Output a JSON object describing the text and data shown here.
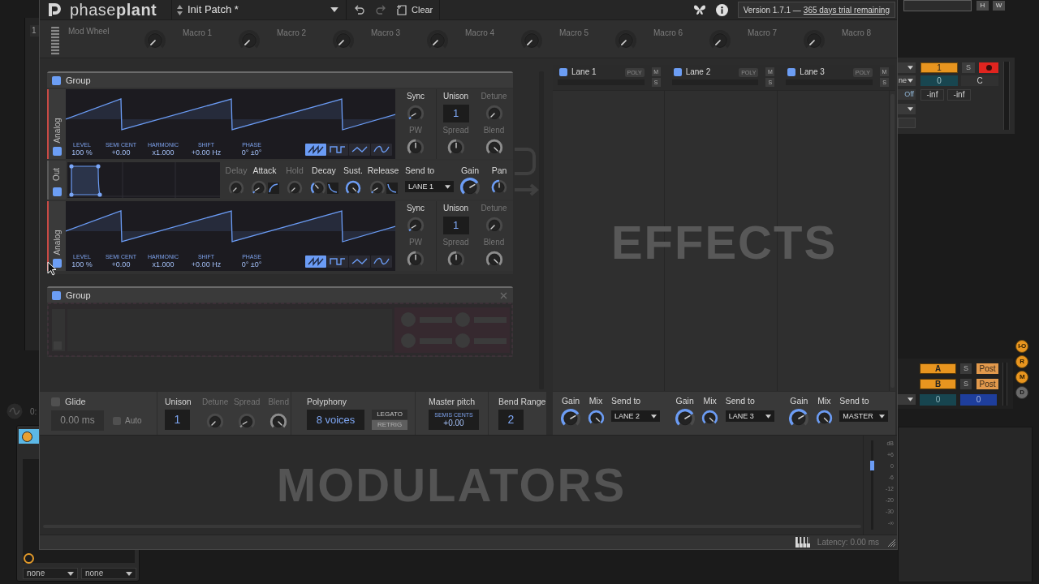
{
  "window": {
    "logo": "phase**plant**",
    "preset": "Init Patch *",
    "clear": "Clear",
    "version": "Version 1.7.1 —",
    "trial": "365 days trial remaining"
  },
  "macros": {
    "mod_wheel": "Mod Wheel",
    "knobs": [
      {
        "label": "Macro 1",
        "kind": "min"
      },
      {
        "label": "Macro 2",
        "kind": "min"
      },
      {
        "label": "Macro 3",
        "kind": "min"
      },
      {
        "label": "Macro 4",
        "kind": "min"
      },
      {
        "label": "Macro 5",
        "kind": "min"
      },
      {
        "label": "Macro 6",
        "kind": "min"
      },
      {
        "label": "Macro 7",
        "kind": "min"
      },
      {
        "label": "Macro 8",
        "kind": "min"
      }
    ]
  },
  "groups": [
    {
      "title": "Group",
      "enabled": true,
      "hovered": false,
      "modules": [
        {
          "kind": "analog",
          "label": "Analog",
          "enabled": true,
          "params": [
            {
              "label": "LEVEL",
              "value": "100 %"
            },
            {
              "label": "SEMI CENT",
              "value": "+0.00"
            },
            {
              "label": "HARMONIC",
              "value": "x1.000"
            },
            {
              "label": "SHIFT",
              "value": "+0.00 Hz"
            },
            {
              "label": "PHASE",
              "value": "0° ±0°"
            }
          ],
          "waveforms": [
            {
              "kind": "saw",
              "selected": true
            },
            {
              "kind": "square",
              "selected": false
            },
            {
              "kind": "triangle",
              "selected": false
            },
            {
              "kind": "sine",
              "selected": false
            }
          ],
          "sync": {
            "label": "Sync",
            "active": true,
            "kind": "low"
          },
          "pw": {
            "label": "PW",
            "active": false,
            "kind": "mid"
          },
          "unison": {
            "label": "Unison",
            "value": "1"
          },
          "detune": {
            "label": "Detune",
            "active": false,
            "kind": "min"
          },
          "spread": {
            "label": "Spread",
            "active": false,
            "kind": "mid"
          },
          "blend": {
            "label": "Blend",
            "active": false,
            "kind": "max"
          }
        },
        {
          "kind": "envelope",
          "label": "Out",
          "enabled": true,
          "stages": [
            {
              "label": "Delay",
              "active": false,
              "kind": "min"
            },
            {
              "label": "Attack",
              "active": true,
              "kind": "low",
              "curve": {
                "kind": "rise"
              }
            },
            {
              "label": "Hold",
              "active": false,
              "kind": "min"
            },
            {
              "label": "Decay",
              "active": true,
              "kind": "third",
              "curve": {
                "kind": "fall"
              }
            },
            {
              "label": "Sust.",
              "active": true,
              "kind": "max"
            },
            {
              "label": "Release",
              "active": true,
              "kind": "low",
              "curve": {
                "kind": "fall"
              }
            }
          ],
          "send_label": "Send to",
          "send_to": "LANE 1",
          "gain": {
            "label": "Gain",
            "active": true,
            "kind": "high"
          },
          "pan": {
            "label": "Pan",
            "active": true,
            "kind": "mid"
          }
        },
        {
          "kind": "analog",
          "label": "Analog",
          "enabled": true,
          "params": [
            {
              "label": "LEVEL",
              "value": "100 %"
            },
            {
              "label": "SEMI CENT",
              "value": "+0.00"
            },
            {
              "label": "HARMONIC",
              "value": "x1.000"
            },
            {
              "label": "SHIFT",
              "value": "+0.00 Hz"
            },
            {
              "label": "PHASE",
              "value": "0° ±0°"
            }
          ],
          "waveforms": [
            {
              "kind": "saw",
              "selected": true
            },
            {
              "kind": "square",
              "selected": false
            },
            {
              "kind": "triangle",
              "selected": false
            },
            {
              "kind": "sine",
              "selected": false
            }
          ],
          "sync": {
            "label": "Sync",
            "active": true,
            "kind": "low"
          },
          "pw": {
            "label": "PW",
            "active": false,
            "kind": "mid"
          },
          "unison": {
            "label": "Unison",
            "value": "1"
          },
          "detune": {
            "label": "Detune",
            "active": false,
            "kind": "min"
          },
          "spread": {
            "label": "Spread",
            "active": false,
            "kind": "mid"
          },
          "blend": {
            "label": "Blend",
            "active": false,
            "kind": "max"
          }
        }
      ]
    },
    {
      "title": "Group",
      "enabled": true,
      "hovered": true
    }
  ],
  "lanes": {
    "placeholder": "EFFECTS",
    "items": [
      {
        "label": "Lane 1",
        "enabled": true,
        "poly": "POLY",
        "mute": "M",
        "solo": "S",
        "gain": {
          "label": "Gain",
          "active": true,
          "kind": "high"
        },
        "mix": {
          "label": "Mix",
          "active": true,
          "kind": "max"
        },
        "send_label": "Send to",
        "send_to": "LANE 2"
      },
      {
        "label": "Lane 2",
        "enabled": true,
        "poly": "POLY",
        "mute": "M",
        "solo": "S",
        "gain": {
          "label": "Gain",
          "active": true,
          "kind": "high"
        },
        "mix": {
          "label": "Mix",
          "active": true,
          "kind": "max"
        },
        "send_label": "Send to",
        "send_to": "LANE 3"
      },
      {
        "label": "Lane 3",
        "enabled": true,
        "poly": "POLY",
        "mute": "M",
        "solo": "S",
        "gain": {
          "label": "Gain",
          "active": true,
          "kind": "high"
        },
        "mix": {
          "label": "Mix",
          "active": true,
          "kind": "max"
        },
        "send_label": "Send to",
        "send_to": "MASTER"
      }
    ]
  },
  "voice": {
    "glide": {
      "label": "Glide",
      "checked": false,
      "value": "0.00 ms"
    },
    "auto": {
      "label": "Auto",
      "checked": false
    },
    "unison": {
      "label": "Unison",
      "value": "1"
    },
    "knobs": [
      {
        "label": "Detune",
        "active": false,
        "kind": "min"
      },
      {
        "label": "Spread",
        "active": false,
        "kind": "low"
      },
      {
        "label": "Blend",
        "active": false,
        "kind": "max"
      }
    ],
    "polyphony": {
      "label": "Polyphony",
      "value": "8 voices"
    },
    "modes": [
      {
        "label": "LEGATO",
        "selected": false
      },
      {
        "label": "RETRIG",
        "selected": true
      }
    ],
    "master_pitch": {
      "label": "Master pitch",
      "units": "SEMIS CENTS",
      "value": "+0.00"
    },
    "bend_range": {
      "label": "Bend Range",
      "value": "2"
    }
  },
  "modulators": {
    "placeholder": "MODULATORS",
    "volume": {
      "level": 0.75
    },
    "scale": [
      "dB",
      "+6",
      "0",
      "-6",
      "-12",
      "-20",
      "-30",
      "-∞"
    ]
  },
  "status_bar": {
    "latency": "Latency: 0.00 ms"
  },
  "host": {
    "top_buttons": [
      "H",
      "W"
    ],
    "left_label": "1",
    "left_time": "0:",
    "track": {
      "number": "1",
      "solo": "S",
      "armed": true,
      "input": "ne",
      "pitch": "0",
      "key": "C",
      "monitor": "Off",
      "volumes": [
        "-inf",
        "-inf"
      ]
    },
    "sends": [
      {
        "label": "A",
        "solo": "S",
        "post": "Post"
      },
      {
        "label": "B",
        "solo": "S",
        "post": "Post"
      }
    ],
    "send_values": [
      "0",
      "0"
    ],
    "modes": [
      {
        "label": "I-O",
        "on": true
      },
      {
        "label": "R",
        "on": true
      },
      {
        "label": "M",
        "on": true
      },
      {
        "label": "D",
        "on": false
      }
    ],
    "device": {
      "inputs": [
        "none",
        "none"
      ]
    }
  }
}
